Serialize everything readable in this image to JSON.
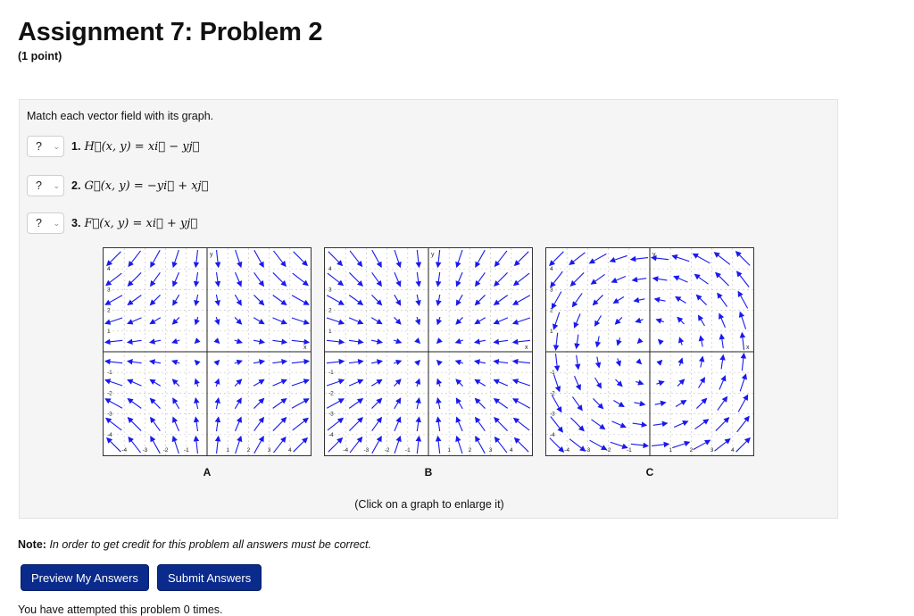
{
  "header": {
    "title": "Assignment 7: Problem 2",
    "points": "(1 point)"
  },
  "problem": {
    "instruction": "Match each vector field with its graph.",
    "questions": [
      {
        "selected": "?",
        "number": "1.",
        "formula": "H⃗(x, y) = xi⃗ − yj⃗"
      },
      {
        "selected": "?",
        "number": "2.",
        "formula": "G⃗(x, y) = −yi⃗ + xj⃗"
      },
      {
        "selected": "?",
        "number": "3.",
        "formula": "F⃗(x, y) = xi⃗ + yj⃗"
      }
    ],
    "graphs": [
      {
        "label": "A",
        "field": "saddle"
      },
      {
        "label": "B",
        "field": "sink"
      },
      {
        "label": "C",
        "field": "rotation"
      }
    ],
    "axis_labels": {
      "x": "x",
      "y": "y"
    },
    "enlarge_hint": "(Click on a graph to enlarge it)"
  },
  "note": {
    "label": "Note:",
    "text": "In order to get credit for this problem all answers must be correct."
  },
  "buttons": {
    "preview": "Preview My Answers",
    "submit": "Submit Answers"
  },
  "attempts": "You have attempted this problem 0 times.",
  "colors": {
    "arrow": "#1a1aee",
    "button": "#0a2a8c",
    "panel": "#f5f5f5"
  }
}
